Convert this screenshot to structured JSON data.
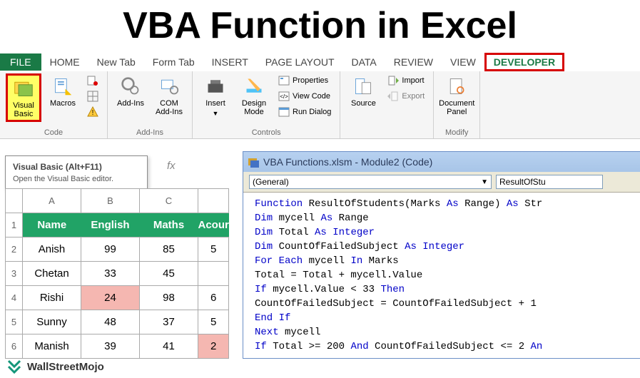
{
  "hero": "VBA Function in Excel",
  "tabs": {
    "file": "FILE",
    "home": "HOME",
    "newtab": "New Tab",
    "formtab": "Form Tab",
    "insert": "INSERT",
    "pagelayout": "PAGE LAYOUT",
    "data": "DATA",
    "review": "REVIEW",
    "view": "VIEW",
    "developer": "DEVELOPER"
  },
  "ribbon": {
    "vb": "Visual\nBasic",
    "macros": "Macros",
    "addins": "Add-Ins",
    "com": "COM\nAdd-Ins",
    "insert": "Insert",
    "design": "Design\nMode",
    "props": "Properties",
    "viewcode": "View Code",
    "rundlg": "Run Dialog",
    "source": "Source",
    "import": "Import",
    "export": "Export",
    "docpanel": "Document\nPanel",
    "g_code": "Code",
    "g_addins": "Add-Ins",
    "g_controls": "Controls",
    "g_modify": "Modify"
  },
  "tooltip": {
    "title": "Visual Basic (Alt+F11)",
    "body": "Open the Visual Basic editor."
  },
  "fx": "fx",
  "sheet": {
    "colhdrs": [
      "A",
      "B",
      "C"
    ],
    "head": [
      "Name",
      "English",
      "Maths",
      "Acour"
    ],
    "rows": [
      {
        "n": "1"
      },
      {
        "n": "2",
        "name": "Anish",
        "eng": "99",
        "mat": "85",
        "ac": "5"
      },
      {
        "n": "3",
        "name": "Chetan",
        "eng": "33",
        "mat": "45",
        "ac": ""
      },
      {
        "n": "4",
        "name": "Rishi",
        "eng": "24",
        "mat": "98",
        "ac": "6",
        "lowEng": true
      },
      {
        "n": "5",
        "name": "Sunny",
        "eng": "48",
        "mat": "37",
        "ac": "5"
      },
      {
        "n": "6",
        "name": "Manish",
        "eng": "39",
        "mat": "41",
        "ac": "2",
        "lowAc": true
      }
    ]
  },
  "vbe": {
    "title": "VBA Functions.xlsm - Module2 (Code)",
    "combo1": "(General)",
    "combo2": "ResultOfStu",
    "lines": [
      {
        "seg": [
          [
            "kw",
            "Function"
          ],
          [
            "txt",
            " ResultOfStudents(Marks "
          ],
          [
            "kw",
            "As"
          ],
          [
            "txt",
            " Range) "
          ],
          [
            "kw",
            "As"
          ],
          [
            "txt",
            " Str"
          ]
        ]
      },
      {
        "seg": [
          [
            "kw",
            "Dim"
          ],
          [
            "txt",
            " mycell "
          ],
          [
            "kw",
            "As"
          ],
          [
            "txt",
            " Range"
          ]
        ]
      },
      {
        "seg": [
          [
            "kw",
            "Dim"
          ],
          [
            "txt",
            " Total "
          ],
          [
            "kw",
            "As Integer"
          ]
        ]
      },
      {
        "seg": [
          [
            "kw",
            "Dim"
          ],
          [
            "txt",
            " CountOfFailedSubject "
          ],
          [
            "kw",
            "As Integer"
          ]
        ]
      },
      {
        "seg": [
          [
            "kw",
            "For Each"
          ],
          [
            "txt",
            " mycell "
          ],
          [
            "kw",
            "In"
          ],
          [
            "txt",
            " Marks"
          ]
        ]
      },
      {
        "seg": [
          [
            "txt",
            "Total = Total + mycell.Value"
          ]
        ]
      },
      {
        "seg": [
          [
            "kw",
            "If"
          ],
          [
            "txt",
            " mycell.Value < 33 "
          ],
          [
            "kw",
            "Then"
          ]
        ]
      },
      {
        "seg": [
          [
            "txt",
            "CountOfFailedSubject = CountOfFailedSubject + 1"
          ]
        ]
      },
      {
        "seg": [
          [
            "kw",
            "End If"
          ]
        ]
      },
      {
        "seg": [
          [
            "kw",
            "Next"
          ],
          [
            "txt",
            " mycell"
          ]
        ]
      },
      {
        "seg": [
          [
            "kw",
            "If"
          ],
          [
            "txt",
            " Total >= 200 "
          ],
          [
            "kw",
            "And"
          ],
          [
            "txt",
            " CountOfFailedSubject <= 2 "
          ],
          [
            "kw",
            "An"
          ]
        ]
      }
    ]
  },
  "wm": "WallStreetMojo"
}
